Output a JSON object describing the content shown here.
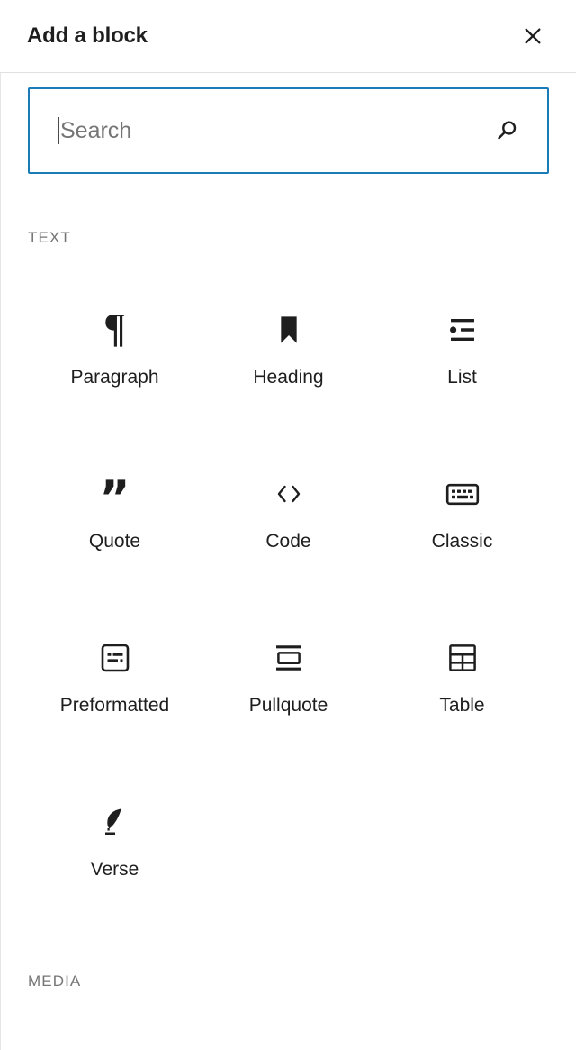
{
  "header": {
    "title": "Add a block",
    "close_label": "Close block inserter",
    "close_icon": "close-icon"
  },
  "search": {
    "value": "",
    "placeholder": "Search",
    "icon": "search-icon",
    "border_color": "#1a7cb7",
    "caret_visible": true
  },
  "categories": [
    {
      "id": "text",
      "title": "TEXT",
      "blocks": [
        {
          "label": "Paragraph",
          "icon": "paragraph-icon",
          "glyph": "¶"
        },
        {
          "label": "Heading",
          "icon": "heading-icon",
          "glyph": ""
        },
        {
          "label": "List",
          "icon": "list-icon",
          "glyph": ""
        },
        {
          "label": "Quote",
          "icon": "quote-icon",
          "glyph": "”"
        },
        {
          "label": "Code",
          "icon": "code-icon",
          "glyph": "‹›"
        },
        {
          "label": "Classic",
          "icon": "classic-icon",
          "glyph": ""
        },
        {
          "label": "Preformatted",
          "icon": "preformatted-icon",
          "glyph": ""
        },
        {
          "label": "Pullquote",
          "icon": "pullquote-icon",
          "glyph": ""
        },
        {
          "label": "Table",
          "icon": "table-icon",
          "glyph": ""
        },
        {
          "label": "Verse",
          "icon": "verse-icon",
          "glyph": ""
        }
      ]
    },
    {
      "id": "media",
      "title": "MEDIA",
      "blocks": []
    }
  ],
  "colors": {
    "accent": "#1a7cb7",
    "text": "#1e1e1e",
    "muted": "#757575",
    "divider": "#e0e0e0",
    "background": "#ffffff"
  }
}
